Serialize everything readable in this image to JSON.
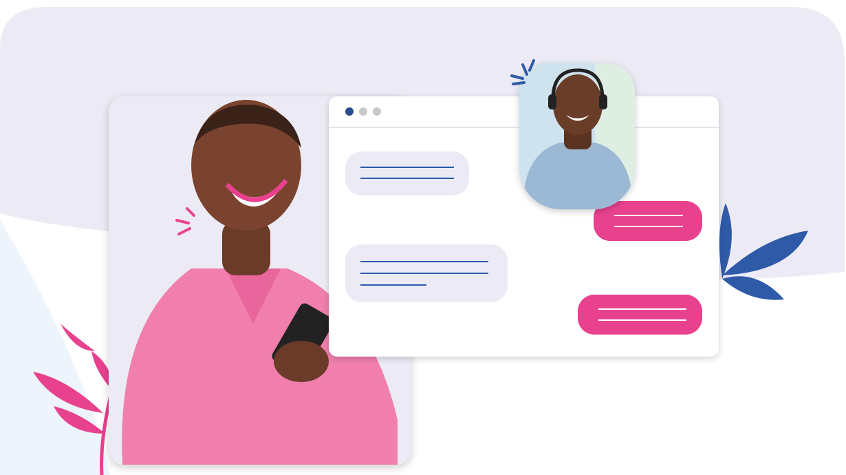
{
  "colors": {
    "background_panel": "#ecebf5",
    "light_blue_bg": "#eef4fb",
    "accent_pink": "#e8428f",
    "accent_blue": "#2f5aa8",
    "incoming_bubble": "#ecebf5",
    "line_blue": "#2a5aa6",
    "line_white": "#ffffff"
  },
  "chat": {
    "window_dots": [
      "#2a4b8d",
      "#c8c8cc",
      "#c8c8cc"
    ],
    "messages": [
      {
        "side": "left",
        "lines": 2
      },
      {
        "side": "right",
        "lines": 2
      },
      {
        "side": "left",
        "lines": 3
      },
      {
        "side": "right",
        "lines": 2
      }
    ]
  },
  "icons": {
    "customer": "woman-with-phone-photo",
    "agent": "man-with-headset-photo",
    "decor_left": "pink-leaf-icon",
    "decor_right": "blue-leaf-icon"
  }
}
